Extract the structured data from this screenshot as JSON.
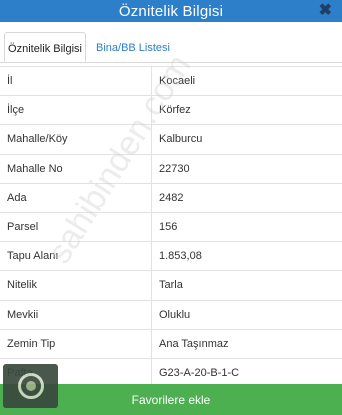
{
  "header": {
    "title": "Öznitelik Bilgisi",
    "close": "✖"
  },
  "tabs": [
    {
      "label": "Öznitelik Bilgisi"
    },
    {
      "label": "Bina/BB Listesi"
    }
  ],
  "attributes": [
    {
      "key": "İl",
      "value": "Kocaeli"
    },
    {
      "key": "İlçe",
      "value": "Körfez"
    },
    {
      "key": "Mahalle/Köy",
      "value": "Kalburcu"
    },
    {
      "key": "Mahalle No",
      "value": "22730"
    },
    {
      "key": "Ada",
      "value": "2482"
    },
    {
      "key": "Parsel",
      "value": "156"
    },
    {
      "key": "Tapu Alanı",
      "value": "1.853,08"
    },
    {
      "key": "Nitelik",
      "value": "Tarla"
    },
    {
      "key": "Mevkii",
      "value": "Oluklu"
    },
    {
      "key": "Zemin Tip",
      "value": "Ana Taşınmaz"
    },
    {
      "key": "Pafta",
      "value": "G23-A-20-B-1-C"
    }
  ],
  "footer": {
    "button_label": "Favorilere ekle"
  },
  "watermark": "sahibinden.com"
}
